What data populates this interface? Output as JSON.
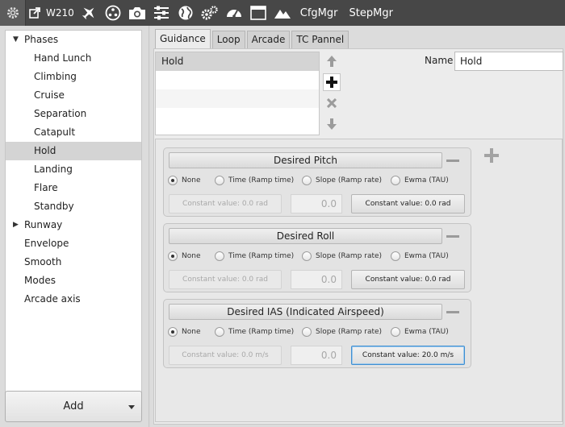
{
  "toolbar": {
    "aircraft_name": "W210",
    "cfgmgr_label": "CfgMgr",
    "stepmgr_label": "StepMgr",
    "icons": [
      "settings-gear-icon",
      "external-link-icon",
      "airplane-icon",
      "radioactive-icon",
      "camera-icon",
      "sliders-icon",
      "globe-icon",
      "gears-icon",
      "gauge-icon",
      "window-icon",
      "mountains-icon"
    ]
  },
  "sidebar": {
    "items": [
      {
        "label": "Phases",
        "expanded": true
      },
      {
        "label": "Hand Lunch"
      },
      {
        "label": "Climbing"
      },
      {
        "label": "Cruise"
      },
      {
        "label": "Separation"
      },
      {
        "label": "Catapult"
      },
      {
        "label": "Hold",
        "selected": true
      },
      {
        "label": "Landing"
      },
      {
        "label": "Flare"
      },
      {
        "label": "Standby"
      },
      {
        "label": "Runway",
        "expanded": false
      },
      {
        "label": "Envelope"
      },
      {
        "label": "Smooth"
      },
      {
        "label": "Modes"
      },
      {
        "label": "Arcade axis"
      }
    ],
    "add_label": "Add"
  },
  "tabs": [
    {
      "label": "Guidance",
      "active": true
    },
    {
      "label": "Loop"
    },
    {
      "label": "Arcade"
    },
    {
      "label": "TC Pannel"
    }
  ],
  "phase_list": {
    "items": [
      "Hold"
    ]
  },
  "name_field": {
    "label": "Name",
    "value": "Hold"
  },
  "groups": [
    {
      "title": "Desired Pitch",
      "options": [
        "None",
        "Time (Ramp time)",
        "Slope (Ramp rate)",
        "Ewma (TAU)"
      ],
      "selected": "None",
      "constant_disabled": "Constant value: 0.0 rad",
      "number": "0.0",
      "constant_button": "Constant value: 0.0 rad"
    },
    {
      "title": "Desired Roll",
      "options": [
        "None",
        "Time (Ramp time)",
        "Slope (Ramp rate)",
        "Ewma (TAU)"
      ],
      "selected": "None",
      "constant_disabled": "Constant value: 0.0 rad",
      "number": "0.0",
      "constant_button": "Constant value: 0.0 rad"
    },
    {
      "title": "Desired IAS (Indicated Airspeed)",
      "options": [
        "None",
        "Time (Ramp time)",
        "Slope (Ramp rate)",
        "Ewma (TAU)"
      ],
      "selected": "None",
      "constant_disabled": "Constant value: 0.0 m/s",
      "number": "0.0",
      "constant_button": "Constant value: 20.0 m/s"
    }
  ]
}
